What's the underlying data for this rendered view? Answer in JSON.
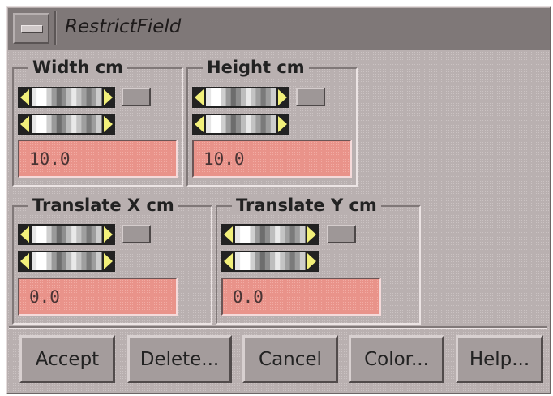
{
  "window": {
    "title": "RestrictField"
  },
  "groups": {
    "width": {
      "label": "Width cm",
      "value": "10.0"
    },
    "height": {
      "label": "Height cm",
      "value": "10.0"
    },
    "translate_x": {
      "label": "Translate X cm",
      "value": "0.0"
    },
    "translate_y": {
      "label": "Translate Y cm",
      "value": "0.0"
    }
  },
  "buttons": {
    "accept": "Accept",
    "delete": "Delete...",
    "cancel": "Cancel",
    "color": "Color...",
    "help": "Help..."
  },
  "colors": {
    "background": "#b9b0b0",
    "titlebar": "#7f7878",
    "field": "#e9938a",
    "arrow": "#f2f07a"
  },
  "icons": {
    "menu": "window-menu-icon",
    "wheel_arrows": [
      "arrow-left-icon",
      "arrow-right-icon"
    ]
  }
}
